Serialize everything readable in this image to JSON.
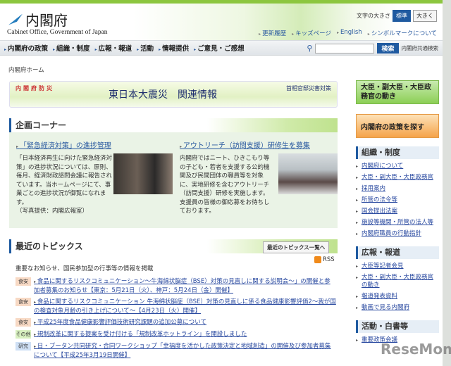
{
  "header": {
    "logo": "内閣府",
    "logo_sub": "Cabinet Office, Government of Japan",
    "font_size_label": "文字の大きさ",
    "font_std": "標準",
    "font_large": "大きく",
    "links": [
      "更新履歴",
      "キッズページ",
      "English",
      "シンボルマークについて"
    ]
  },
  "nav": {
    "items": [
      "内閣府の政策",
      "組織・制度",
      "広報・報道",
      "活動",
      "情報提供",
      "ご意見・ご感想"
    ],
    "search_button": "検索",
    "search_label": "内閣府共通検索",
    "search_value": ""
  },
  "breadcrumb": "内閣府ホーム",
  "banner": {
    "left": "内閣府防災",
    "title": "東日本大震災　関連情報",
    "right": "首相官邸災害対策"
  },
  "corner": {
    "title": "企画コーナー",
    "items": [
      {
        "title": "「緊急経済対策」の進捗管理",
        "text": "「日本経済再生に向けた緊急経済対策」の進捗状況については、原則、毎月、経済財政諮問会議に報告されています。当ホームページにて、事業ごとの進捗状況が御覧になれます。",
        "credit": "（写真提供：内閣広報室）"
      },
      {
        "title": "アウトリーチ（訪問支援）研修生を募集",
        "text": "内閣府ではニート、ひきこもり等の子ども・若者を支援する公的機関及び民間団体の職員等を対象に、実地研修を含むアウトリーチ（訪問支援）研修を実施します。支援員の皆様の御応募をお待ちしております。"
      }
    ]
  },
  "topics": {
    "title": "最近のトピックス",
    "more": "最近のトピックス一覧へ",
    "rss": "RSS",
    "desc": "重要なお知らせ、国民参加型の行事等の情報を掲載",
    "items": [
      {
        "badge": "食安",
        "color": "#f7d9c4",
        "text": "食品に関するリスクコミュニケーション～牛海綿状脳症（BSE）対策の見直しに関する説明会～」の開催と参加者募集のお知らせ【東京：5月21日（火）、神戸：5月24日（金）開催】"
      },
      {
        "badge": "食安",
        "color": "#f7d9c4",
        "text": "食品に関するリスクコミュニケーション 牛海綿状脳症（BSE）対策の見直しに係る食品健康影響評価2～我が国の検査対象月齢の引き上げについて～【4月23日（火）開催】"
      },
      {
        "badge": "食安",
        "color": "#f7d9c4",
        "text": "平成25年度食品健康影響評価技術研究課題の追加公募について"
      },
      {
        "badge": "その他",
        "color": "#d8f0c0",
        "text": "規制改革に関する提案を受け付ける「規制改革ホットライン」を開設しました"
      },
      {
        "badge": "研究",
        "color": "#cfe0f5",
        "text": "日・ブータン共同研究・合同ワークショップ「幸福度を活かした政策決定と地域創造」の開催及び参加者募集について【平成25年3月19日開催】"
      }
    ]
  },
  "sidebar": {
    "box1": "大臣・副大臣・大臣政務官の動き",
    "box2": "内閣府の政策を探す",
    "sections": [
      {
        "title": "組織・制度",
        "links": [
          "内閣府について",
          "大臣・副大臣・大臣政務官",
          "採用案内",
          "所管の法令等",
          "国会提出法案",
          "施設等機関・所管の法人等",
          "内閣府職員の行動指針"
        ]
      },
      {
        "title": "広報・報道",
        "links": [
          "大臣等記者会見",
          "大臣・副大臣・大臣政務官の動き",
          "報道発表資料",
          "動画で見る内閣府"
        ]
      },
      {
        "title": "活動・白書等",
        "links": [
          "重要政策会議"
        ]
      }
    ]
  },
  "watermark": "ReseMom"
}
